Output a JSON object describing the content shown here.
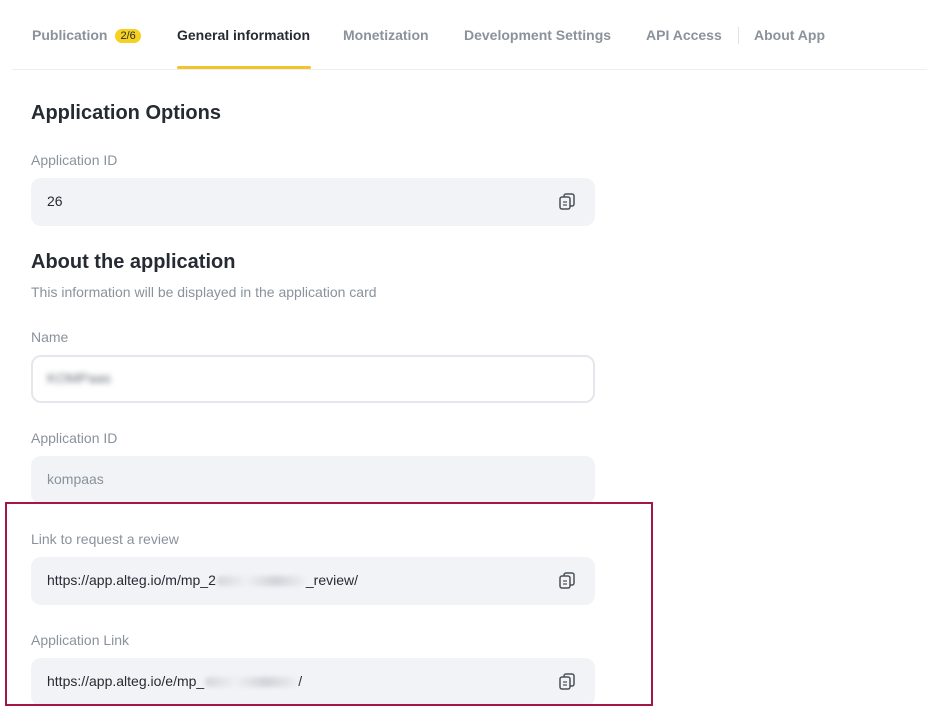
{
  "tabs": [
    {
      "label": "Publication",
      "badge": "2/6"
    },
    {
      "label": "General information"
    },
    {
      "label": "Monetization"
    },
    {
      "label": "Development Settings"
    },
    {
      "label": "API Access"
    },
    {
      "label": "About App"
    }
  ],
  "active_tab": "General information",
  "accent_color": "#f2c42a",
  "highlight_color": "#a3164a",
  "options": {
    "title": "Application Options",
    "app_id_label": "Application ID",
    "app_id_value": "26"
  },
  "about": {
    "title": "About the application",
    "subtitle": "This information will be displayed in the application card",
    "name_label": "Name",
    "name_value": "KOMPaas",
    "app_id_label": "Application ID",
    "app_id_placeholder": "kompaas",
    "review_link_label": "Link to request a review",
    "review_link_prefix": "https://app.alteg.io/m/mp_2",
    "review_link_suffix": "_review/",
    "app_link_label": "Application Link",
    "app_link_prefix": "https://app.alteg.io/e/mp_",
    "app_link_suffix": "/"
  },
  "icons": {
    "copy": "copy-icon"
  }
}
